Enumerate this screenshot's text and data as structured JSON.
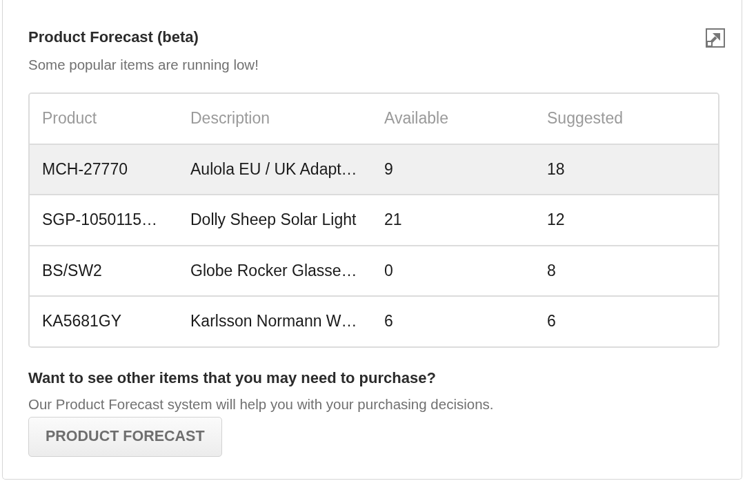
{
  "card": {
    "title": "Product Forecast (beta)",
    "subtitle": "Some popular items are running low!"
  },
  "table": {
    "columns": [
      "Product",
      "Description",
      "Available",
      "Suggested"
    ],
    "rows": [
      {
        "selected": true,
        "cells": [
          "MCH-27770",
          "Aulola EU / UK Adapt…",
          "9",
          "18"
        ]
      },
      {
        "selected": false,
        "cells": [
          "SGP-1050115…",
          "Dolly Sheep Solar Light",
          "21",
          "12"
        ]
      },
      {
        "selected": false,
        "cells": [
          "BS/SW2",
          "Globe Rocker Glasse…",
          "0",
          "8"
        ]
      },
      {
        "selected": false,
        "cells": [
          "KA5681GY",
          "Karlsson Normann W…",
          "6",
          "6"
        ]
      }
    ]
  },
  "promo": {
    "heading": "Want to see other items that you may need to purchase?",
    "text": "Our Product Forecast system will help you with your purchasing decisions.",
    "button": "PRODUCT FORECAST"
  }
}
